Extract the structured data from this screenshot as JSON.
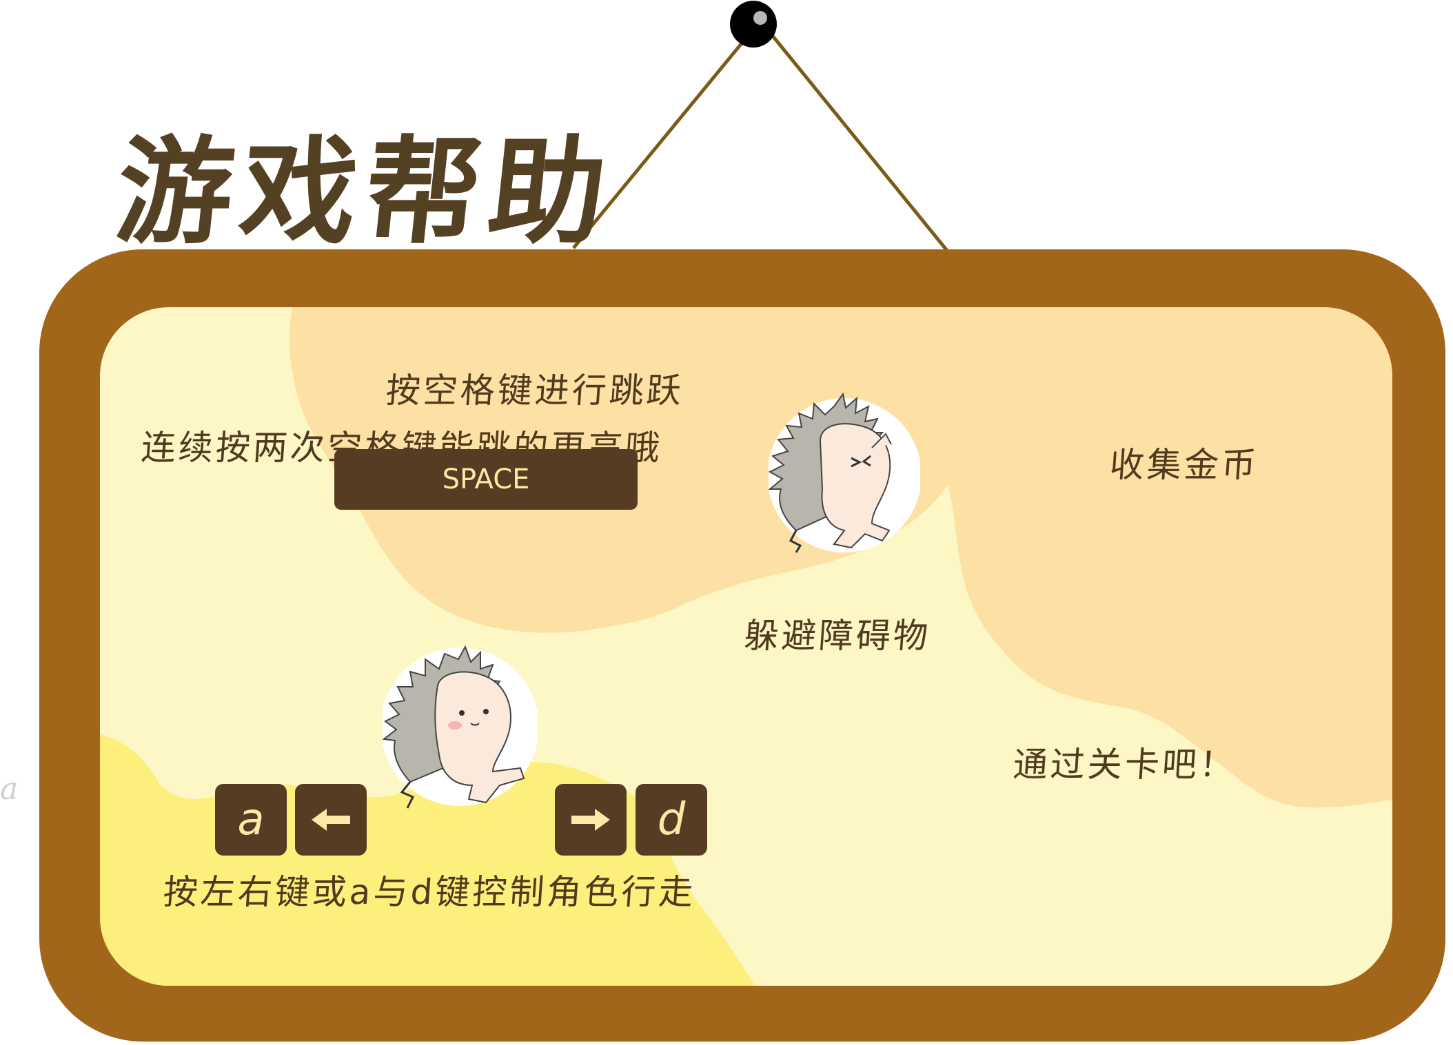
{
  "title": "游戏帮助",
  "hints": {
    "jump": "按空格键进行跳跃",
    "double_jump": "连续按两次空格键能跳的更高哦",
    "move": "按左右键或a与d键控制角色行走",
    "avoid": "躲避障碍物",
    "collect": "收集金币",
    "goal": "通过关卡吧！"
  },
  "keys": {
    "space": "SPACE",
    "a": "a",
    "d": "d",
    "left_icon": "arrow-left-icon",
    "right_icon": "arrow-right-icon"
  },
  "stray_letter": "a",
  "colors": {
    "frame": "#a2661a",
    "panel": "#fdf6c5",
    "text": "#4f3a1e",
    "key_bg": "#553c22",
    "key_text": "#fbe9a7",
    "blob_orange": "#fde0a4",
    "blob_yellow": "#fcef7c",
    "string": "#7a5a16",
    "pin": "#000000"
  }
}
